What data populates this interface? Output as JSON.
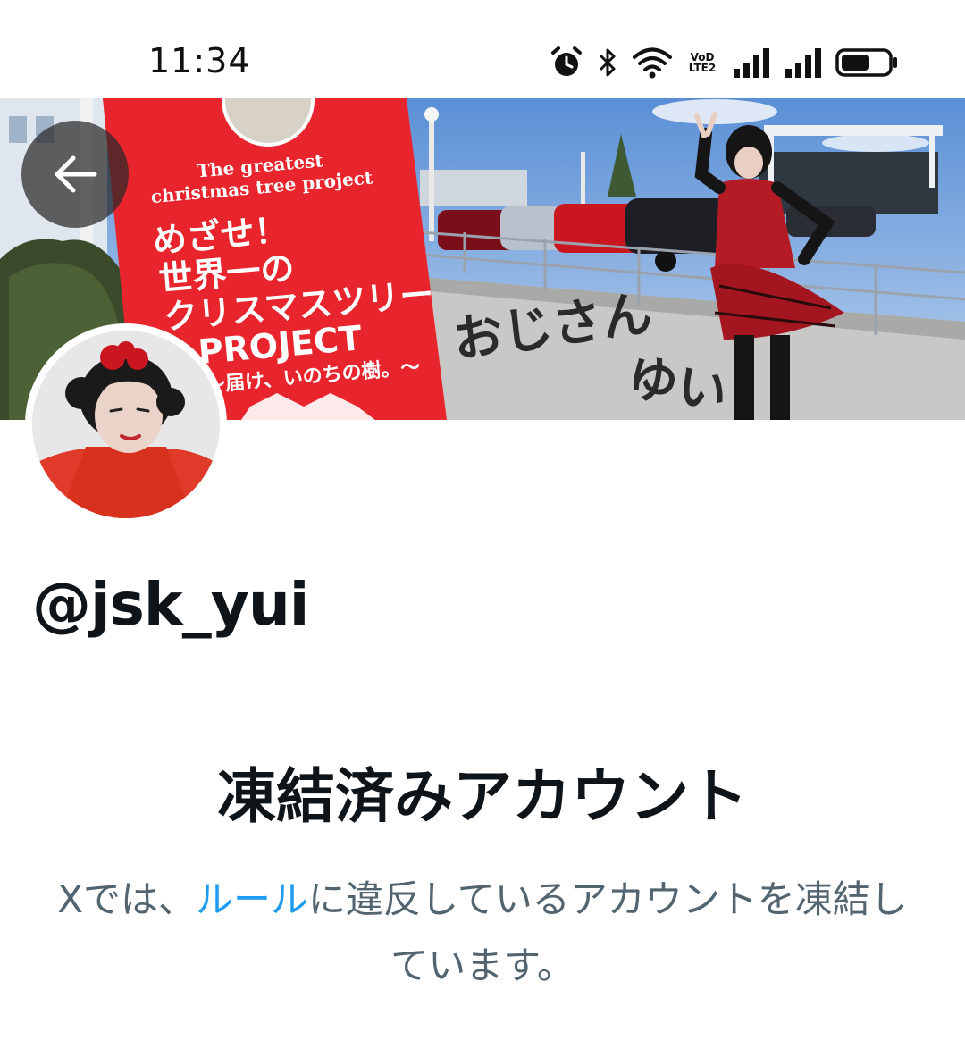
{
  "status_bar": {
    "time": "11:34",
    "icons": [
      "alarm-icon",
      "bluetooth-icon",
      "wifi-icon",
      "volte-icon",
      "signal-icon",
      "signal-icon",
      "battery-icon"
    ],
    "volte_label_1": "VoD",
    "volte_label_2": "LTE2",
    "battery_level": 0.6
  },
  "banner": {
    "sign_line_1": "The greatest",
    "sign_line_2": "christmas tree project",
    "sign_jp_1": "めざせ！",
    "sign_jp_2": "世界一の",
    "sign_jp_3": "クリスマスツリー",
    "sign_jp_4": "PROJECT",
    "sign_jp_5": "〜届け、いのちの樹。〜"
  },
  "nav": {
    "back_icon": "arrow-left-icon"
  },
  "profile": {
    "handle": "@jsk_yui"
  },
  "suspension": {
    "title": "凍結済みアカウント",
    "desc_prefix": "Xでは、",
    "desc_link": "ルール",
    "desc_suffix": "に違反しているアカウントを凍結しています。"
  },
  "colors": {
    "link": "#1d9bf0",
    "secondary_text": "#536471",
    "primary_text": "#0f1419",
    "sign_red": "#e8242c"
  }
}
